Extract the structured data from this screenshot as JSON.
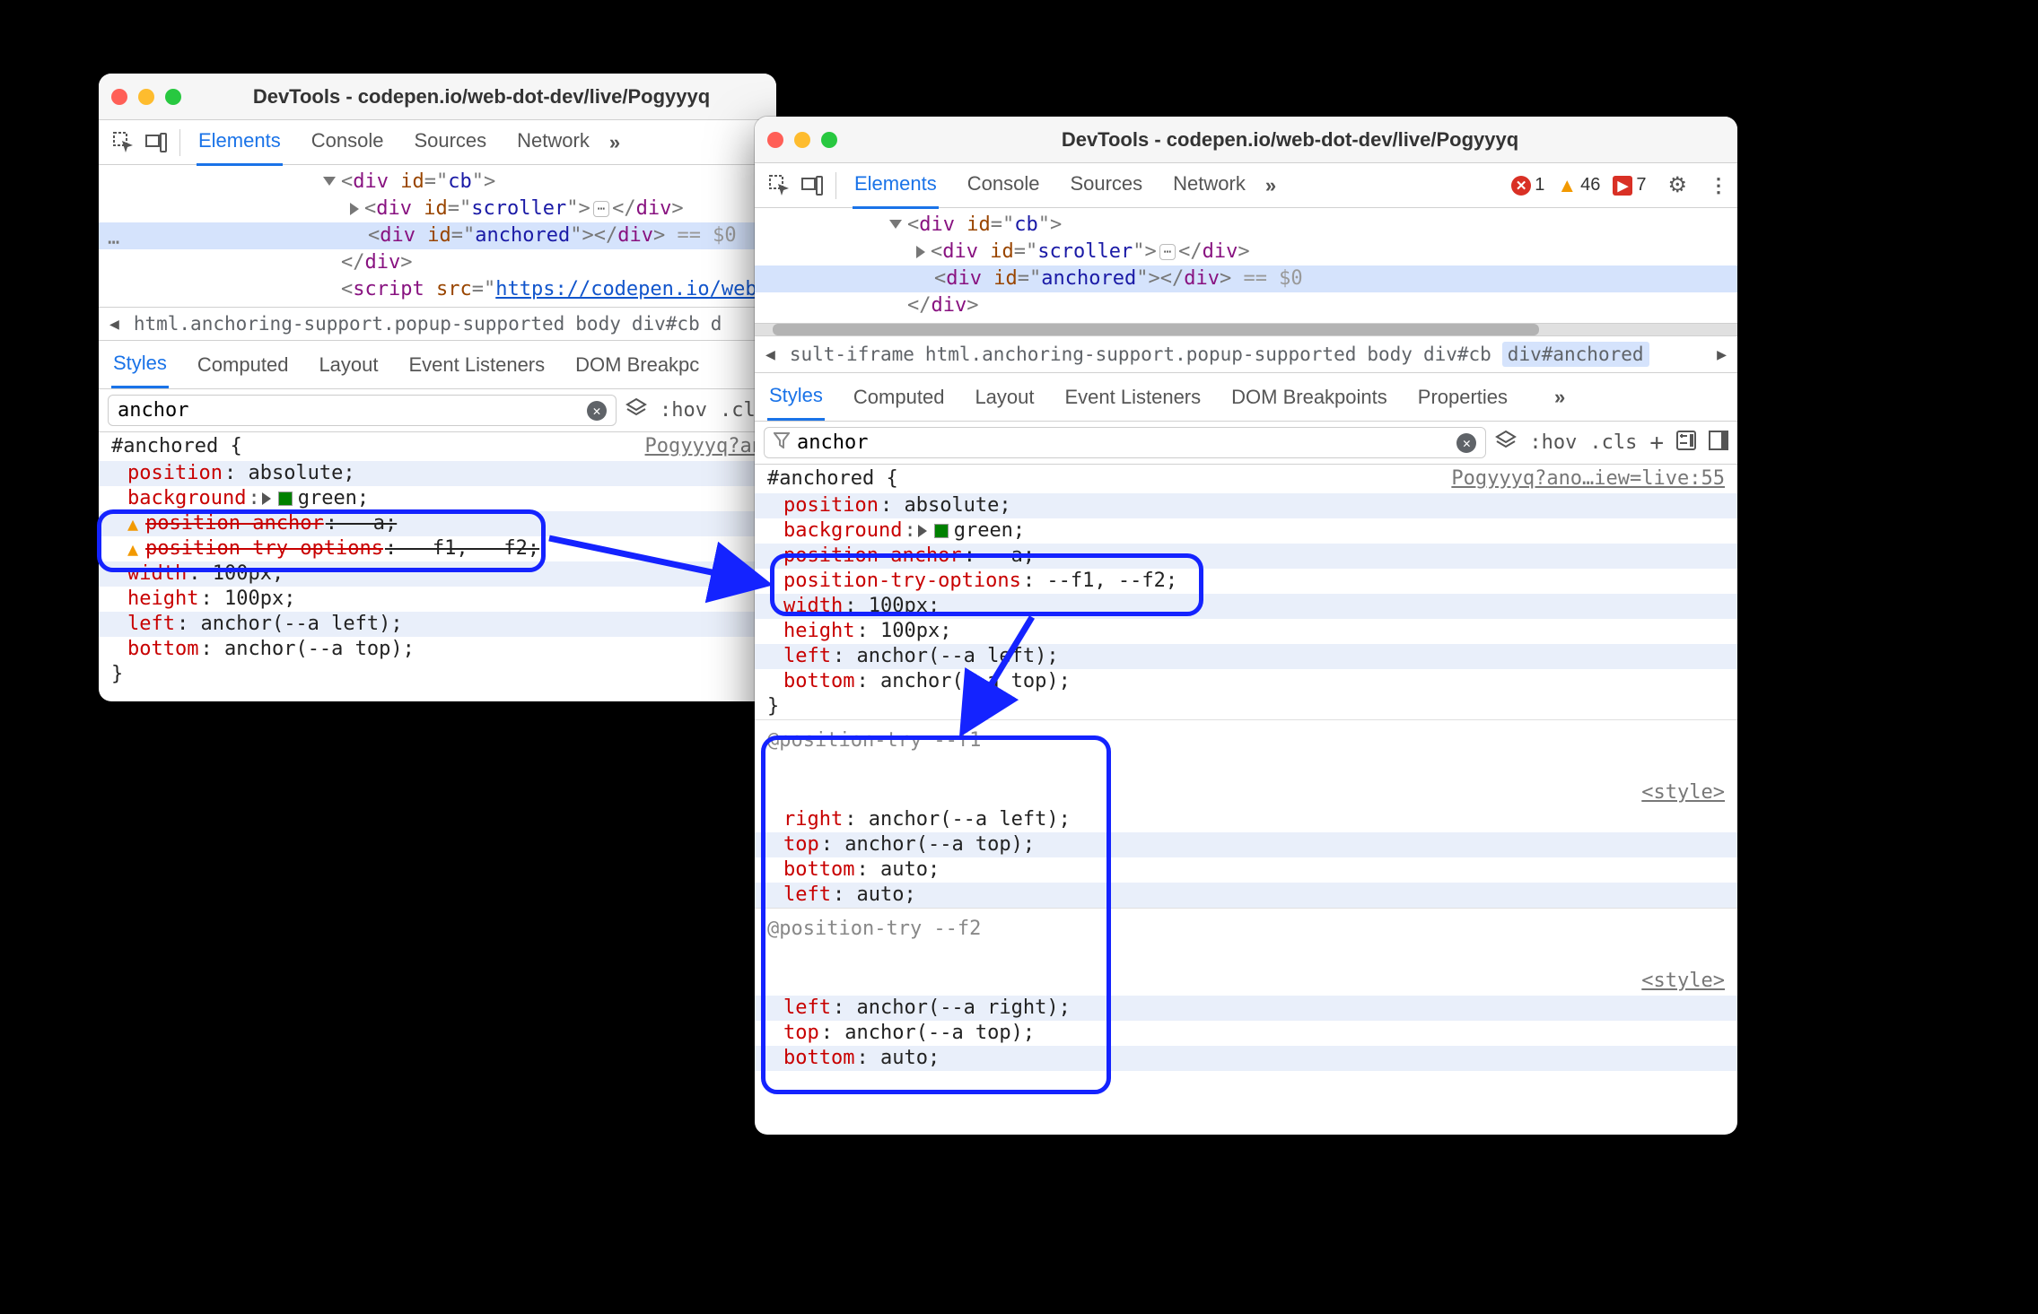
{
  "windows": {
    "left": {
      "title": "DevTools - codepen.io/web-dot-dev/live/Pogyyyq",
      "tabs": [
        "Elements",
        "Console",
        "Sources",
        "Network"
      ],
      "active_tab": "Elements",
      "dom_lines": {
        "cb_open": "<div id=\"cb\">",
        "scroller": "<div id=\"scroller\">…</div>",
        "anchored": "<div id=\"anchored\"></div>",
        "anchored_eq": " == $0",
        "cb_close": "</div>",
        "script_open": "<script src=\"",
        "script_url": "https://codepen.io/web-dot-d"
      },
      "breadcrumb": [
        "html.anchoring-support.popup-supported",
        "body",
        "div#cb"
      ],
      "subtabs": [
        "Styles",
        "Computed",
        "Layout",
        "Event Listeners",
        "DOM Breakpc"
      ],
      "active_subtab": "Styles",
      "filter_value": "anchor",
      "filter_btn_hov": ":hov",
      "filter_btn_cls": ".cls",
      "rule_source": "Pogyyyq?an",
      "rule": {
        "selector": "#anchored {",
        "position": {
          "p": "position",
          "v": ": absolute;"
        },
        "background": {
          "p": "background",
          "v": "green;"
        },
        "pos_anchor": {
          "p": "position-anchor",
          "v": ": --a;"
        },
        "pos_try": {
          "p": "position-try-options",
          "v": ": --f1, --f2;"
        },
        "width": {
          "p": "width",
          "v": ": 100px;"
        },
        "height": {
          "p": "height",
          "v": ": 100px;"
        },
        "left": {
          "p": "left",
          "v": ": anchor(--a left);"
        },
        "bottom": {
          "p": "bottom",
          "v": ": anchor(--a top);"
        },
        "close": "}"
      }
    },
    "right": {
      "title": "DevTools - codepen.io/web-dot-dev/live/Pogyyyq",
      "tabs": [
        "Elements",
        "Console",
        "Sources",
        "Network"
      ],
      "active_tab": "Elements",
      "badges": {
        "errors": "1",
        "warnings": "46",
        "info": "7"
      },
      "dom_lines": {
        "cb_open": "<div id=\"cb\">",
        "scroller": "<div id=\"scroller\">…</div>",
        "anchored": "<div id=\"anchored\"></div>",
        "anchored_eq": " == $0",
        "cb_close": "</div>"
      },
      "breadcrumb": [
        "sult-iframe",
        "html.anchoring-support.popup-supported",
        "body",
        "div#cb",
        "div#anchored"
      ],
      "selected_crumb": "div#anchored",
      "subtabs": [
        "Styles",
        "Computed",
        "Layout",
        "Event Listeners",
        "DOM Breakpoints",
        "Properties"
      ],
      "active_subtab": "Styles",
      "filter_value": "anchor",
      "filter_btn_hov": ":hov",
      "filter_btn_cls": ".cls",
      "rule_source": "Pogyyyq?ano…iew=live:55",
      "rule": {
        "selector": "#anchored {",
        "position": {
          "p": "position",
          "v": ": absolute;"
        },
        "background": {
          "p": "background",
          "v": "green;"
        },
        "pos_anchor": {
          "p": "position-anchor",
          "v": ": --a;"
        },
        "pos_try": {
          "p": "position-try-options",
          "v": ": --f1, --f2;"
        },
        "width": {
          "p": "width",
          "v": ": 100px;"
        },
        "height": {
          "p": "height",
          "v": ": 100px;"
        },
        "left": {
          "p": "left",
          "v": ": anchor(--a left);"
        },
        "bottom": {
          "p": "bottom",
          "v": ": anchor(--a top);"
        },
        "close": "}"
      },
      "pt1": {
        "header": "@position-try --f1",
        "style_link": "<style>",
        "right": {
          "p": "right",
          "v": ": anchor(--a left);"
        },
        "top": {
          "p": "top",
          "v": ": anchor(--a top);"
        },
        "bottom": {
          "p": "bottom",
          "v": ": auto;"
        },
        "left": {
          "p": "left",
          "v": ": auto;"
        }
      },
      "pt2": {
        "header": "@position-try --f2",
        "style_link": "<style>",
        "left": {
          "p": "left",
          "v": ": anchor(--a right);"
        },
        "top": {
          "p": "top",
          "v": ": anchor(--a top);"
        },
        "bottom": {
          "p": "bottom",
          "v": ": auto;"
        }
      }
    }
  }
}
